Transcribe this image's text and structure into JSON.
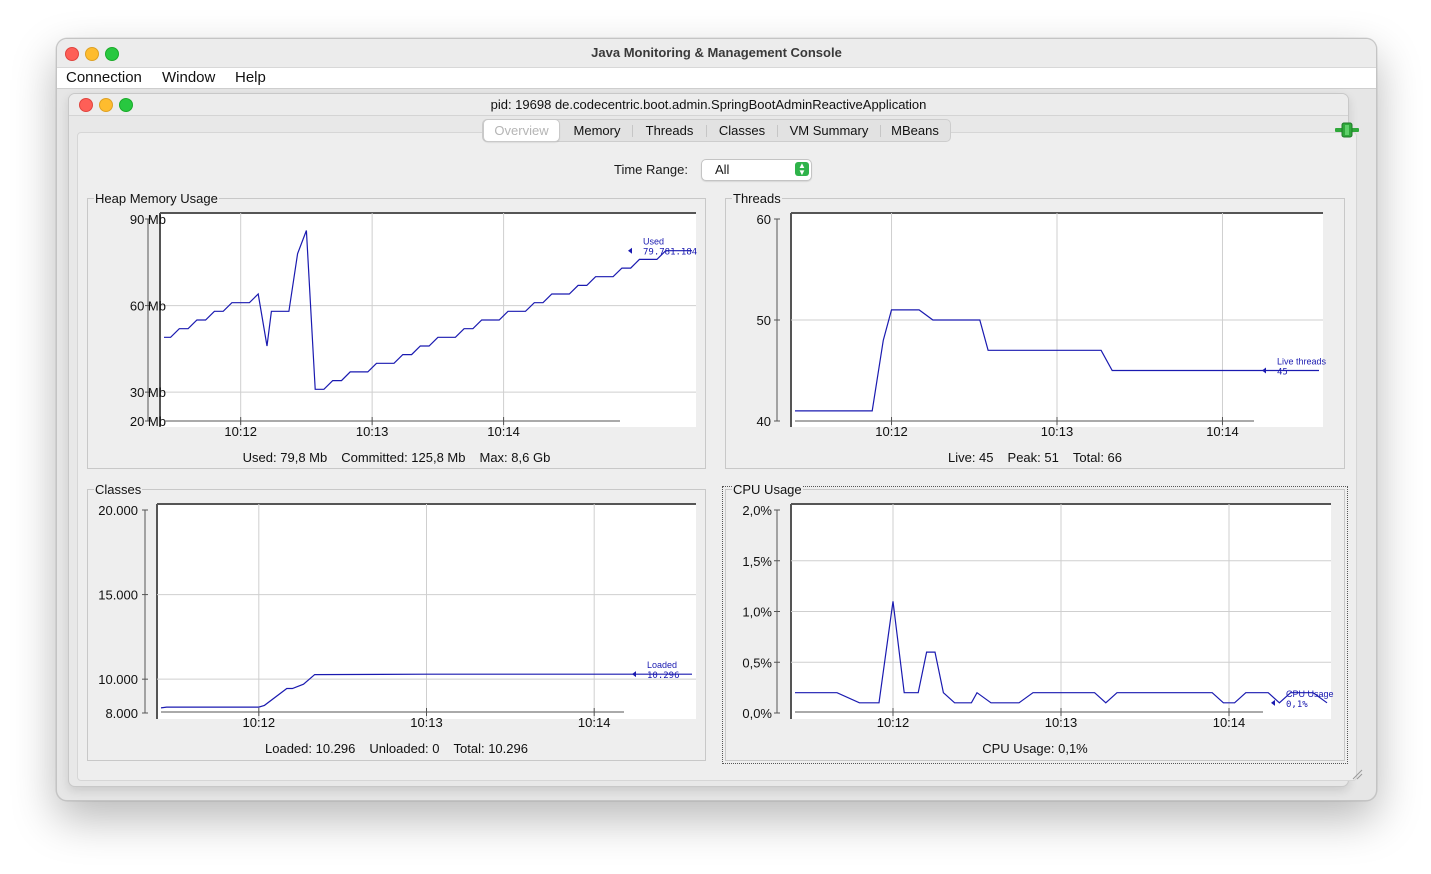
{
  "window": {
    "title": "Java Monitoring & Management Console",
    "menu": [
      "Connection",
      "Window",
      "Help"
    ]
  },
  "inner_window": {
    "title": "pid: 19698 de.codecentric.boot.admin.SpringBootAdminReactiveApplication"
  },
  "tabs": [
    {
      "label": "Overview",
      "active": true
    },
    {
      "label": "Memory",
      "active": false
    },
    {
      "label": "Threads",
      "active": false
    },
    {
      "label": "Classes",
      "active": false
    },
    {
      "label": "VM Summary",
      "active": false
    },
    {
      "label": "MBeans",
      "active": false
    }
  ],
  "time_range": {
    "label": "Time Range:",
    "selected": "All"
  },
  "colors": {
    "series": "#1a1ab0",
    "connection_icon": "#2fa83a"
  },
  "chart_data": [
    {
      "id": "heap",
      "type": "line",
      "title": "Heap Memory Usage",
      "x": [
        "10:11:25",
        "10:11:28",
        "10:11:32",
        "10:11:36",
        "10:11:40",
        "10:11:44",
        "10:11:48",
        "10:11:52",
        "10:11:56",
        "10:12:00",
        "10:12:04",
        "10:12:08",
        "10:12:12",
        "10:12:14",
        "10:12:18",
        "10:12:22",
        "10:12:26",
        "10:12:30",
        "10:12:34",
        "10:12:38",
        "10:12:42",
        "10:12:46",
        "10:12:50",
        "10:12:54",
        "10:12:58",
        "10:13:02",
        "10:13:06",
        "10:13:10",
        "10:13:14",
        "10:13:18",
        "10:13:22",
        "10:13:26",
        "10:13:30",
        "10:13:34",
        "10:13:38",
        "10:13:42",
        "10:13:46",
        "10:13:50",
        "10:13:54",
        "10:13:58",
        "10:14:02",
        "10:14:06",
        "10:14:10",
        "10:14:14",
        "10:14:18",
        "10:14:22",
        "10:14:26",
        "10:14:30",
        "10:14:34",
        "10:14:38",
        "10:14:42",
        "10:14:46",
        "10:14:50",
        "10:14:54",
        "10:14:58",
        "10:15:02",
        "10:15:06",
        "10:15:10",
        "10:15:14",
        "10:15:18",
        "10:15:22",
        "10:15:26"
      ],
      "series": [
        {
          "name": "Used",
          "values": [
            49,
            49,
            52,
            52,
            55,
            55,
            58,
            58,
            61,
            61,
            61,
            64,
            46,
            58,
            58,
            58,
            78,
            86,
            31,
            31,
            34,
            34,
            37,
            37,
            37,
            40,
            40,
            40,
            43,
            43,
            46,
            46,
            49,
            49,
            49,
            52,
            52,
            55,
            55,
            55,
            58,
            58,
            58,
            61,
            61,
            64,
            64,
            64,
            67,
            67,
            70,
            70,
            70,
            73,
            73,
            76,
            76,
            76,
            79,
            79,
            79,
            79
          ]
        }
      ],
      "ylim": [
        20,
        90
      ],
      "yticks": [
        {
          "value": 90,
          "label": "90 Mb"
        },
        {
          "value": 60,
          "label": "60 Mb"
        },
        {
          "value": 30,
          "label": "30 Mb"
        },
        {
          "value": 20,
          "label": "20 Mb"
        }
      ],
      "xticks": [
        "10:12",
        "10:13",
        "10:14"
      ],
      "legend": {
        "name": "Used",
        "value": "79.781.184"
      },
      "summary": [
        "Used: 79,8 Mb",
        "Committed: 125,8 Mb",
        "Max: 8,6 Gb"
      ]
    },
    {
      "id": "threads",
      "type": "line",
      "title": "Threads",
      "x": [
        "10:11:25",
        "10:11:53",
        "10:11:57",
        "10:12:00",
        "10:12:10",
        "10:12:15",
        "10:12:32",
        "10:12:35",
        "10:13:16",
        "10:13:20",
        "10:14:35"
      ],
      "series": [
        {
          "name": "Live threads",
          "values": [
            41,
            41,
            48,
            51,
            51,
            50,
            50,
            47,
            47,
            45,
            45
          ]
        }
      ],
      "ylim": [
        40,
        60
      ],
      "yticks": [
        {
          "value": 60,
          "label": "60"
        },
        {
          "value": 50,
          "label": "50"
        },
        {
          "value": 40,
          "label": "40"
        }
      ],
      "xticks": [
        "10:12",
        "10:13",
        "10:14"
      ],
      "legend": {
        "name": "Live threads",
        "value": "45"
      },
      "summary": [
        "Live: 45",
        "Peak: 51",
        "Total: 66"
      ]
    },
    {
      "id": "classes",
      "type": "line",
      "title": "Classes",
      "x": [
        "10:11:25",
        "10:11:27",
        "10:11:57",
        "10:12:00",
        "10:12:02",
        "10:12:10",
        "10:12:12",
        "10:12:16",
        "10:12:20",
        "10:13:00",
        "10:14:00",
        "10:14:35"
      ],
      "series": [
        {
          "name": "Loaded",
          "values": [
            8300,
            8350,
            8350,
            8350,
            8450,
            9450,
            9450,
            9700,
            10270,
            10296,
            10296,
            10296
          ]
        }
      ],
      "ylim": [
        8000,
        20000
      ],
      "yticks": [
        {
          "value": 20000,
          "label": "20.000"
        },
        {
          "value": 15000,
          "label": "15.000"
        },
        {
          "value": 10000,
          "label": "10.000"
        },
        {
          "value": 8000,
          "label": "8.000"
        }
      ],
      "xticks": [
        "10:12",
        "10:13",
        "10:14"
      ],
      "legend": {
        "name": "Loaded",
        "value": "10.296"
      },
      "summary": [
        "Loaded: 10.296",
        "Unloaded: 0",
        "Total: 10.296"
      ]
    },
    {
      "id": "cpu",
      "type": "line",
      "title": "CPU Usage",
      "x": [
        "10:11:25",
        "10:11:37",
        "10:11:40",
        "10:11:48",
        "10:11:55",
        "10:12:00",
        "10:12:04",
        "10:12:06",
        "10:12:09",
        "10:12:12",
        "10:12:15",
        "10:12:18",
        "10:12:22",
        "10:12:26",
        "10:12:28",
        "10:12:30",
        "10:12:35",
        "10:12:40",
        "10:12:45",
        "10:12:50",
        "10:12:55",
        "10:13:00",
        "10:13:06",
        "10:13:12",
        "10:13:16",
        "10:13:20",
        "10:13:24",
        "10:13:30",
        "10:13:36",
        "10:13:42",
        "10:13:48",
        "10:13:54",
        "10:13:58",
        "10:14:02",
        "10:14:06",
        "10:14:10",
        "10:14:14",
        "10:14:18",
        "10:14:22",
        "10:14:26",
        "10:14:30",
        "10:14:35"
      ],
      "series": [
        {
          "name": "CPU Usage",
          "values": [
            0.2,
            0.2,
            0.2,
            0.1,
            0.1,
            1.1,
            0.2,
            0.2,
            0.2,
            0.6,
            0.6,
            0.2,
            0.1,
            0.1,
            0.1,
            0.2,
            0.1,
            0.1,
            0.1,
            0.2,
            0.2,
            0.2,
            0.2,
            0.2,
            0.1,
            0.2,
            0.2,
            0.2,
            0.2,
            0.2,
            0.2,
            0.2,
            0.1,
            0.1,
            0.2,
            0.2,
            0.2,
            0.1,
            0.2,
            0.2,
            0.2,
            0.1
          ]
        }
      ],
      "ylim": [
        0,
        2
      ],
      "yticks": [
        {
          "value": 2.0,
          "label": "2,0%"
        },
        {
          "value": 1.5,
          "label": "1,5%"
        },
        {
          "value": 1.0,
          "label": "1,0%"
        },
        {
          "value": 0.5,
          "label": "0,5%"
        },
        {
          "value": 0.0,
          "label": "0,0%"
        }
      ],
      "xticks": [
        "10:12",
        "10:13",
        "10:14"
      ],
      "legend": {
        "name": "CPU Usage",
        "value": "0,1%"
      },
      "summary": [
        "CPU Usage: 0,1%"
      ]
    }
  ]
}
